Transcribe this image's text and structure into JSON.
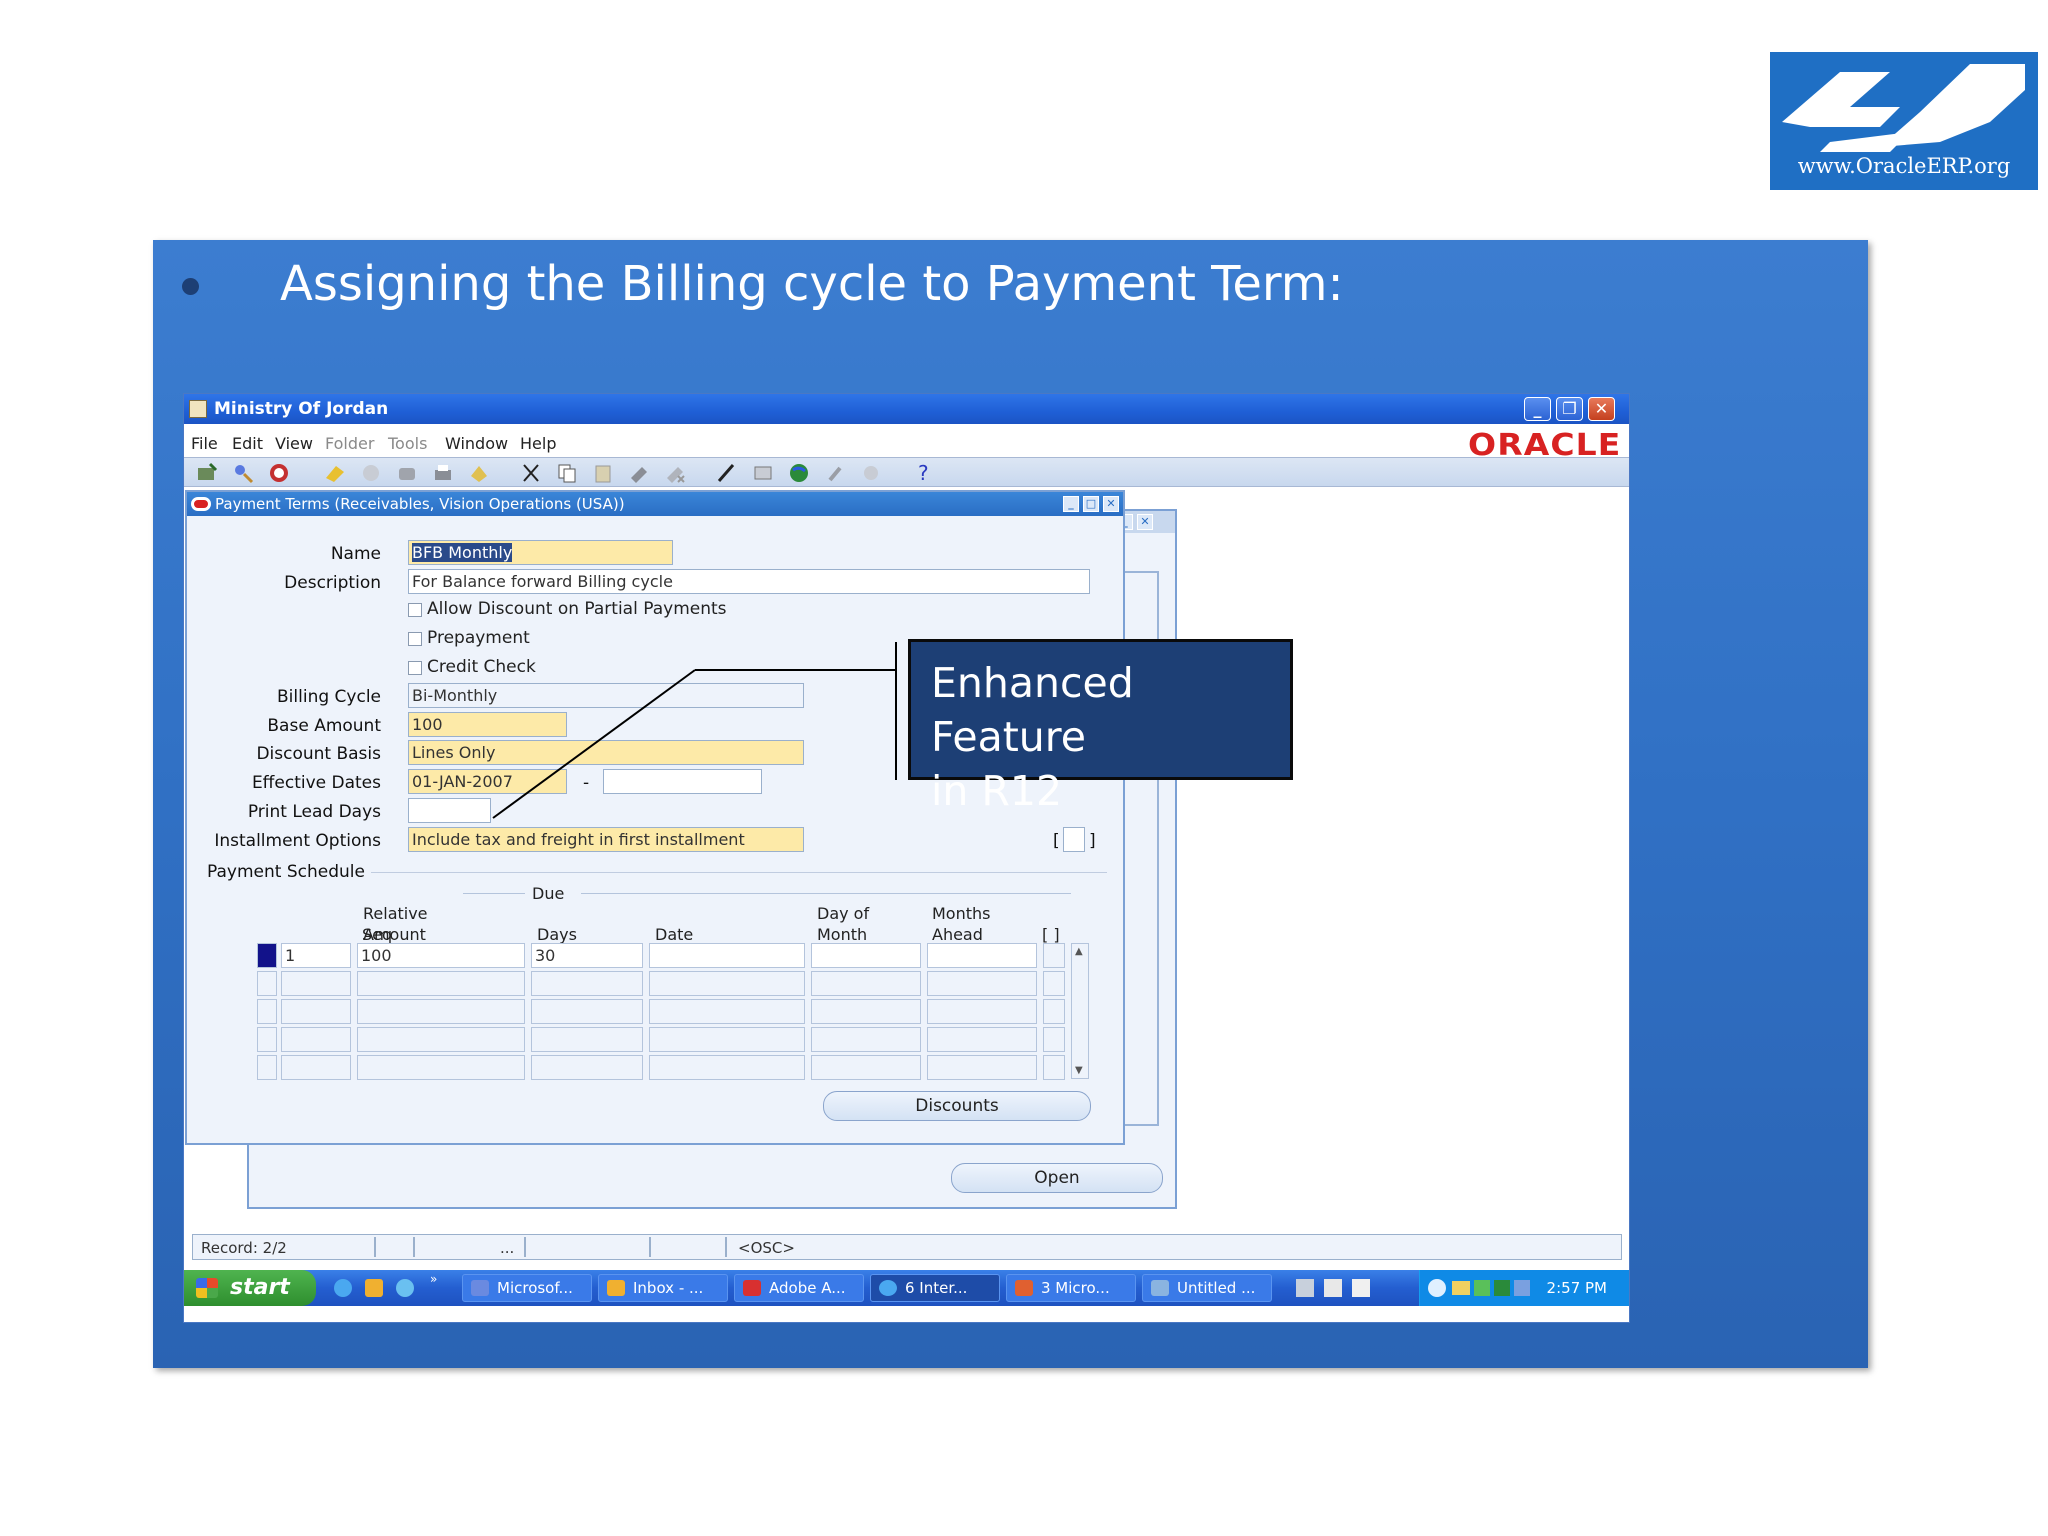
{
  "logo": {
    "text": "www.OracleERP.org"
  },
  "slide": {
    "title": "Assigning the Billing cycle to Payment Term:"
  },
  "window": {
    "title": "Ministry Of Jordan",
    "menus": [
      "File",
      "Edit",
      "View",
      "Folder",
      "Tools",
      "Window",
      "Help"
    ],
    "oracle_brand": "ORACLE",
    "minimize": "_",
    "restore": "❐",
    "close": "✕"
  },
  "form": {
    "title": "Payment Terms (Receivables, Vision Operations (USA))",
    "labels": {
      "name": "Name",
      "description": "Description",
      "billing_cycle": "Billing Cycle",
      "base_amount": "Base Amount",
      "discount_basis": "Discount Basis",
      "effective_dates": "Effective Dates",
      "print_lead_days": "Print Lead Days",
      "installment_options": "Installment Options",
      "payment_schedule": "Payment Schedule",
      "date_dash": "-"
    },
    "values": {
      "name": "BFB Monthly",
      "description": "For Balance forward Billing cycle",
      "billing_cycle": "Bi-Monthly",
      "base_amount": "100",
      "discount_basis": "Lines Only",
      "effective_from": "01-JAN-2007",
      "effective_to": "",
      "print_lead_days": "",
      "installment_options": "Include tax and freight in first installment"
    },
    "checkboxes": {
      "allow_discount": "Allow Discount on Partial Payments",
      "prepayment": "Prepayment",
      "credit_check": "Credit Check"
    },
    "schedule": {
      "due_group": "Due",
      "headers": {
        "seq": "Seq",
        "relative": "Relative",
        "amount": "Amount",
        "days": "Days",
        "date": "Date",
        "day_of": "Day of",
        "month": "Month",
        "months": "Months",
        "ahead": "Ahead",
        "flex": "[ ]"
      },
      "rows": [
        {
          "seq": "1",
          "amount": "100",
          "days": "30",
          "date": "",
          "day_of_month": "",
          "months_ahead": ""
        },
        {
          "seq": "",
          "amount": "",
          "days": "",
          "date": "",
          "day_of_month": "",
          "months_ahead": ""
        },
        {
          "seq": "",
          "amount": "",
          "days": "",
          "date": "",
          "day_of_month": "",
          "months_ahead": ""
        },
        {
          "seq": "",
          "amount": "",
          "days": "",
          "date": "",
          "day_of_month": "",
          "months_ahead": ""
        },
        {
          "seq": "",
          "amount": "",
          "days": "",
          "date": "",
          "day_of_month": "",
          "months_ahead": ""
        }
      ]
    },
    "flex_bracket_open": "[",
    "flex_bracket_close": "]",
    "discounts_button": "Discounts",
    "open_button": "Open"
  },
  "status": {
    "record": "Record: 2/2",
    "ellipsis": "...",
    "osc": "<OSC>"
  },
  "taskbar": {
    "start": "start",
    "tasks": [
      "Microsof...",
      "Inbox - ...",
      "Adobe A...",
      "6 Inter...",
      "3 Micro...",
      "Untitled ..."
    ],
    "clock": "2:57 PM"
  },
  "callout": {
    "line1": "Enhanced Feature",
    "line2": "in R12"
  }
}
